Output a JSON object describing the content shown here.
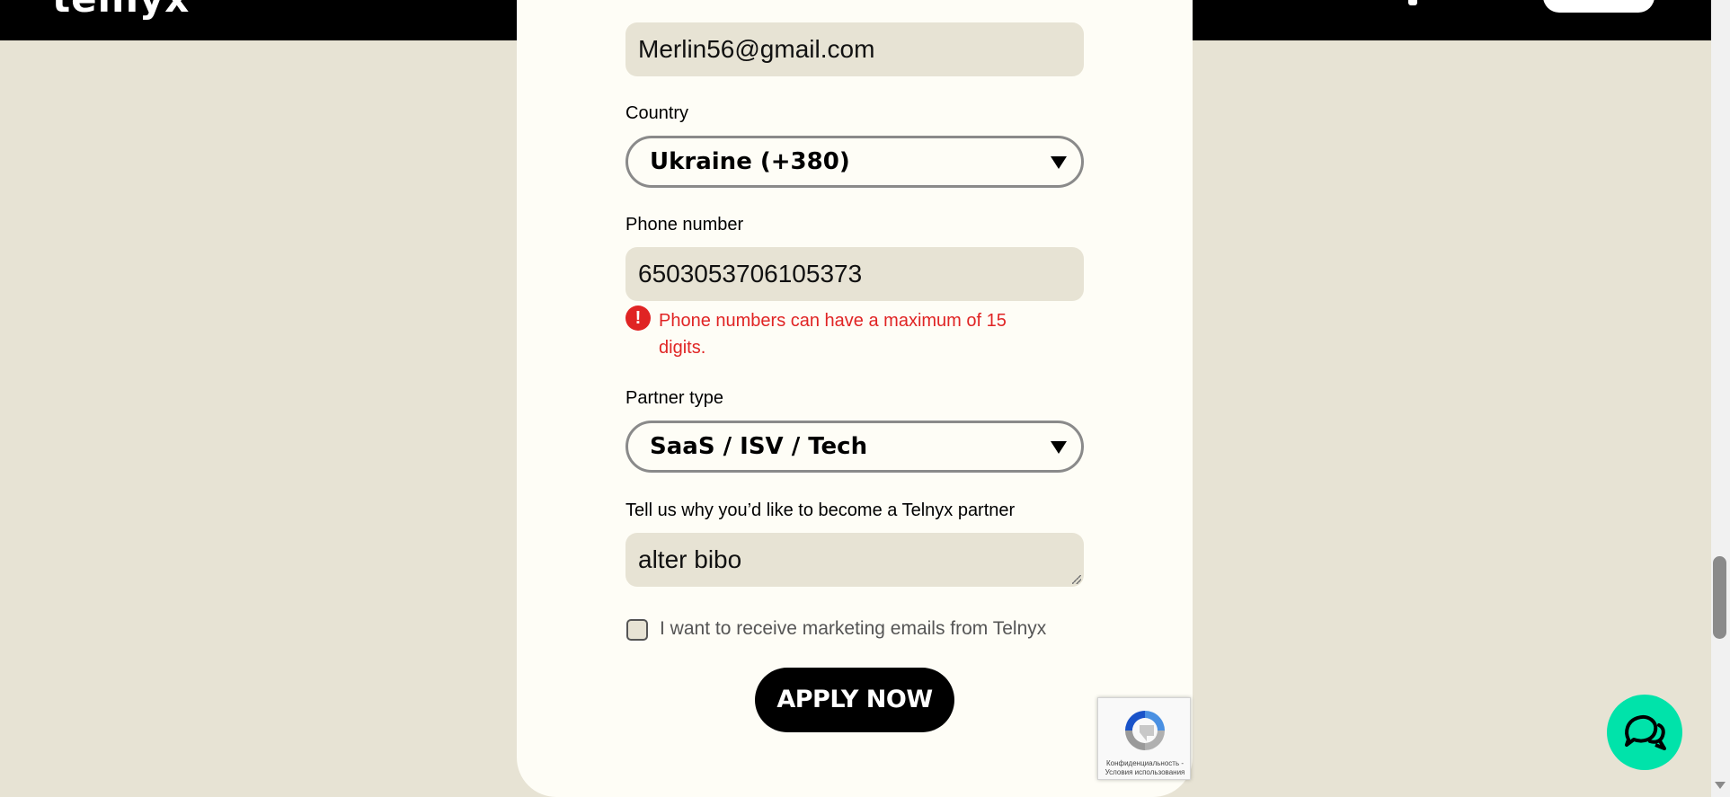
{
  "header": {
    "logo_text": "telnyx"
  },
  "form": {
    "email_value": "Merlin56@gmail.com",
    "country_label": "Country",
    "country_value": "Ukraine (+380)",
    "phone_label": "Phone number",
    "phone_value": "6503053706105373",
    "phone_error": "Phone numbers can have a maximum of 15 digits.",
    "partner_type_label": "Partner type",
    "partner_type_value": "SaaS / ISV / Tech",
    "reason_label": "Tell us why you’d like to become a Telnyx partner",
    "reason_value": "alter bibo",
    "marketing_checkbox_label": "I want to receive marketing emails from Telnyx",
    "marketing_checked": false,
    "submit_label": "APPLY NOW"
  },
  "recaptcha": {
    "text": "Конфиденциальность - Условия использования"
  },
  "colors": {
    "page_bg": "#e7e3d4",
    "card_bg": "#fefdf6",
    "error": "#e02424",
    "chat_button": "#00e3aa",
    "topbar": "#000000"
  },
  "icons": {
    "error": "exclamation-circle-icon",
    "dropdown": "triangle-down-icon",
    "chat": "chat-bubbles-icon",
    "recaptcha": "recaptcha-logo-icon"
  }
}
